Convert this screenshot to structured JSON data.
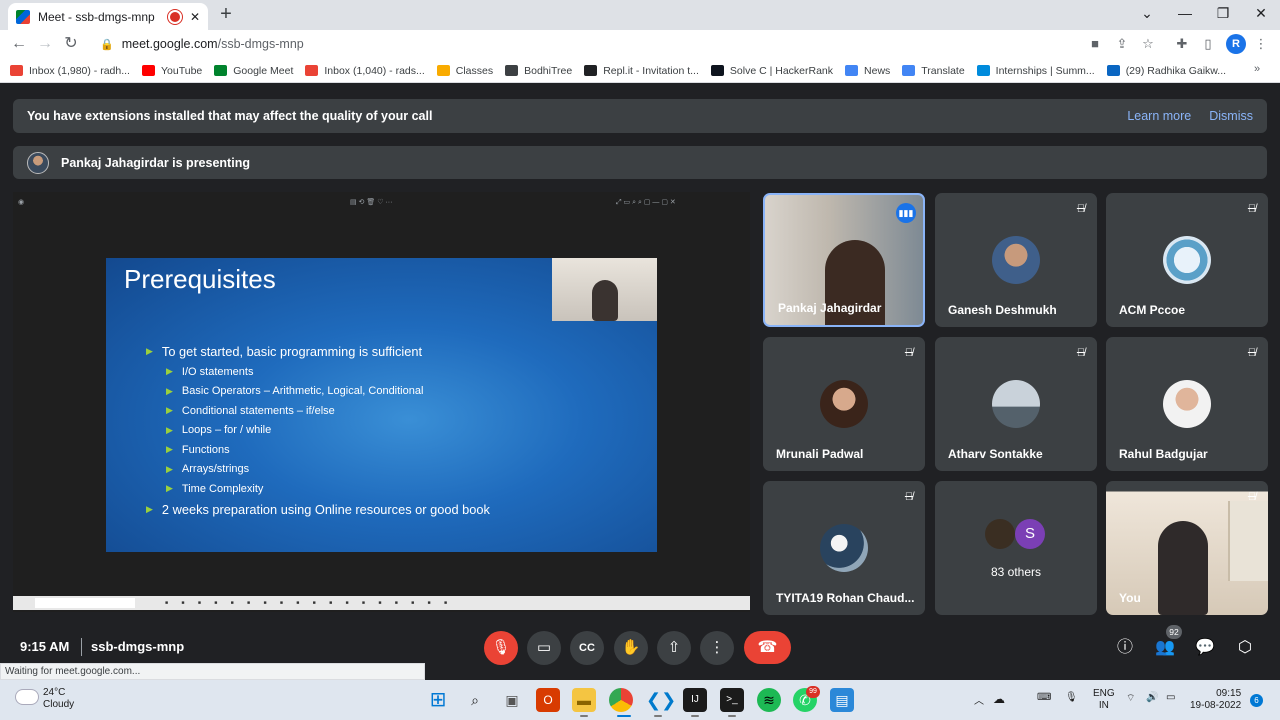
{
  "browser": {
    "tab_title": "Meet - ssb-dmgs-mnp",
    "url_host": "meet.google.com",
    "url_path": "/ssb-dmgs-mnp",
    "profile_initial": "R",
    "bookmarks": [
      {
        "label": "Inbox (1,980) - radh...",
        "color": "#ea4335"
      },
      {
        "label": "YouTube",
        "color": "#ff0000"
      },
      {
        "label": "Google Meet",
        "color": "#00832d"
      },
      {
        "label": "Inbox (1,040) - rads...",
        "color": "#ea4335"
      },
      {
        "label": "Classes",
        "color": "#f9ab00"
      },
      {
        "label": "BodhiTree",
        "color": "#3c4043"
      },
      {
        "label": "Repl.it - Invitation t...",
        "color": "#202124"
      },
      {
        "label": "Solve C | HackerRank",
        "color": "#0e141e"
      },
      {
        "label": "News",
        "color": "#4285f4"
      },
      {
        "label": "Translate",
        "color": "#4285f4"
      },
      {
        "label": "Internships | Summ...",
        "color": "#008bdc"
      },
      {
        "label": "(29) Radhika Gaikw...",
        "color": "#0a66c2"
      }
    ],
    "status_text": "Waiting for meet.google.com..."
  },
  "meet": {
    "extension_banner": "You have extensions installed that may affect the quality of your call",
    "learn_more": "Learn more",
    "dismiss": "Dismiss",
    "presenting_text": "Pankaj Jahagirdar is presenting",
    "time": "9:15 AM",
    "meeting_code": "ssb-dmgs-mnp",
    "participants_count": "92",
    "slide": {
      "title": "Prerequisites",
      "bullets": [
        {
          "text": "To get started, basic programming is sufficient",
          "level": 0
        },
        {
          "text": "I/O statements",
          "level": 1
        },
        {
          "text": "Basic Operators – Arithmetic, Logical, Conditional",
          "level": 1
        },
        {
          "text": "Conditional statements – if/else",
          "level": 1
        },
        {
          "text": "Loops – for / while",
          "level": 1
        },
        {
          "text": "Functions",
          "level": 1
        },
        {
          "text": "Arrays/strings",
          "level": 1
        },
        {
          "text": "Time Complexity",
          "level": 1
        },
        {
          "text": "2 weeks preparation using Online resources or good book",
          "level": 0
        }
      ]
    },
    "participants": [
      {
        "name": "Pankaj Jahagirdar",
        "speaking": true
      },
      {
        "name": "Ganesh Deshmukh",
        "muted": true
      },
      {
        "name": "ACM Pccoe",
        "muted": true
      },
      {
        "name": "Mrunali Padwal",
        "muted": true
      },
      {
        "name": "Atharv Sontakke",
        "muted": true
      },
      {
        "name": "Rahul Badgujar",
        "muted": true
      },
      {
        "name": "TYITA19 Rohan Chaud...",
        "muted": true
      },
      {
        "name": "83 others",
        "initial": "S"
      },
      {
        "name": "You",
        "muted": true
      }
    ]
  },
  "windows": {
    "weather_temp": "24°C",
    "weather_desc": "Cloudy",
    "lang": "ENG",
    "region": "IN",
    "clock_time": "09:15",
    "clock_date": "19-08-2022",
    "notif_count": "6",
    "whatsapp_badge": "99"
  }
}
